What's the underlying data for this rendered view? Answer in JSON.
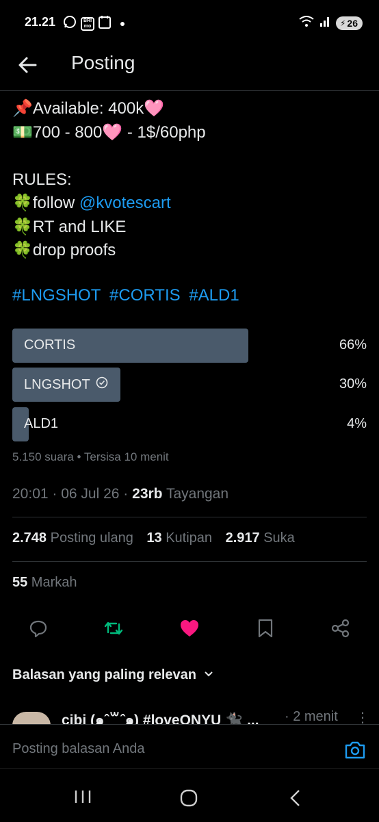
{
  "status_bar": {
    "time": "21.21",
    "bank_icon_text": "BRI mo",
    "battery": "26",
    "icons": [
      "whatsapp-icon",
      "bank-app-icon",
      "calendar-icon",
      "wifi-icon",
      "signal-icon",
      "battery-icon"
    ]
  },
  "header": {
    "title": "Posting"
  },
  "tweet": {
    "line1": "📌Available: 400k🩷",
    "line2": "💵700 - 800🩷 - 1$/60php",
    "rules_title": "RULES:",
    "rule1_prefix": "🍀follow ",
    "rule1_mention": "@kvotescart",
    "rule2": "🍀RT and LIKE",
    "rule3": "🍀drop proofs",
    "hashtags": [
      "#LNGSHOT",
      "#CORTIS",
      "#ALD1"
    ]
  },
  "poll": {
    "options": [
      {
        "label": "CORTIS",
        "percent_text": "66%",
        "percent": 66,
        "selected": false
      },
      {
        "label": "LNGSHOT",
        "percent_text": "30%",
        "percent": 30,
        "selected": true
      },
      {
        "label": "ALD1",
        "percent_text": "4%",
        "percent": 4,
        "selected": false
      }
    ],
    "meta": "5.150 suara • Tersisa 10 menit"
  },
  "meta": {
    "time": "20:01",
    "sep1": " · ",
    "date": "06 Jul 26",
    "sep2": " · ",
    "views_count": "23rb",
    "views_label": " Tayangan"
  },
  "stats": {
    "reposts_count": "2.748",
    "reposts_label": " Posting ulang",
    "quotes_count": "13",
    "quotes_label": " Kutipan",
    "likes_count": "2.917",
    "likes_label": " Suka",
    "bookmarks_count": "55",
    "bookmarks_label": " Markah"
  },
  "actions": {
    "colors": {
      "repost": "#00ba7c",
      "like": "#f91880",
      "default": "#71767b"
    }
  },
  "replies": {
    "sort_label": "Balasan yang paling relevan",
    "first_reply_name": "cibi (๑ˆ꒳ˆ๑) #loveONYU 🐈‍⬛ ...",
    "first_reply_time": "· 2 menit"
  },
  "compose": {
    "placeholder": "Posting balasan Anda"
  },
  "colors": {
    "accent": "#1d9bf0",
    "poll_bar": "#4a5a6b",
    "muted": "#71767b"
  }
}
